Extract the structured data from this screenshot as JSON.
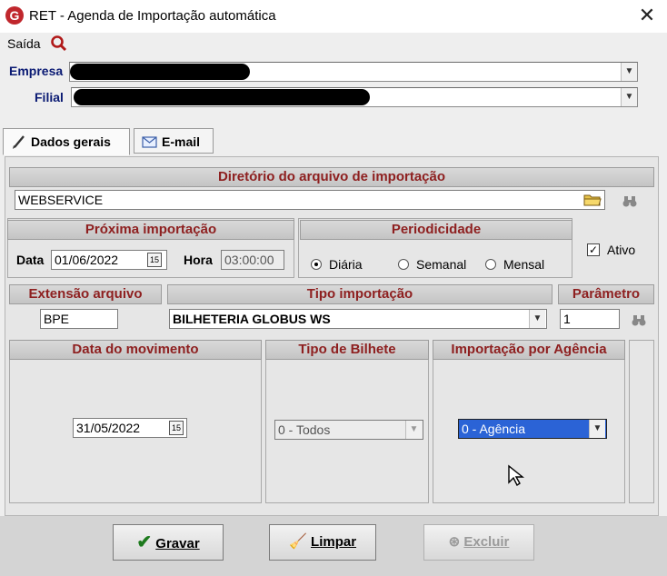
{
  "window": {
    "title": "RET - Agenda de Importação automática",
    "logo_letter": "G"
  },
  "menu": {
    "saida_label": "Saída"
  },
  "empresa": {
    "label": "Empresa"
  },
  "filial": {
    "label": "Filial"
  },
  "tabs": [
    {
      "label": "Dados gerais"
    },
    {
      "label": "E-mail"
    }
  ],
  "diretorio": {
    "header": "Diretório do arquivo de importação",
    "value": "WEBSERVICE"
  },
  "proxima": {
    "header": "Próxima importação",
    "data_label": "Data",
    "data_value": "01/06/2022",
    "hora_label": "Hora",
    "hora_value": "03:00:00"
  },
  "periodicidade": {
    "header": "Periodicidade",
    "options": [
      "Diária",
      "Semanal",
      "Mensal"
    ],
    "selected": "Diária"
  },
  "ativo": {
    "label": "Ativo",
    "checked": true
  },
  "extensao": {
    "header": "Extensão arquivo",
    "value": "BPE"
  },
  "tipo_importacao": {
    "header": "Tipo importação",
    "value": "BILHETERIA GLOBUS WS"
  },
  "parametro": {
    "header": "Parâmetro",
    "value": "1"
  },
  "data_movimento": {
    "header": "Data do movimento",
    "value": "31/05/2022"
  },
  "tipo_bilhete": {
    "header": "Tipo de Bilhete",
    "value": "0 - Todos"
  },
  "importacao_agencia": {
    "header": "Importação por Agência",
    "value": "0 - Agência"
  },
  "buttons": {
    "gravar": "Gravar",
    "limpar": "Limpar",
    "excluir": "Excluir"
  }
}
